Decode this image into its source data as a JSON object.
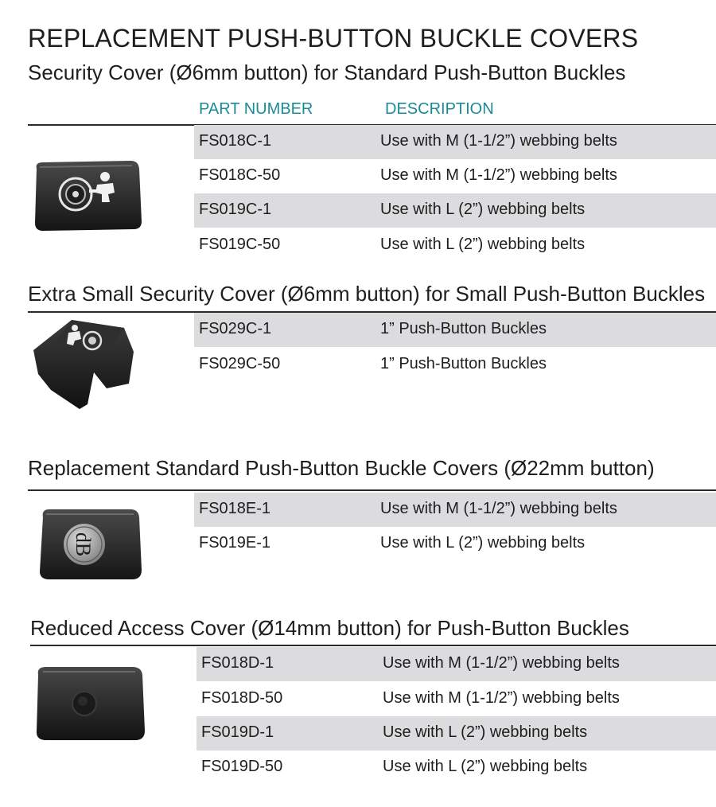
{
  "page_title": "REPLACEMENT PUSH-BUTTON BUCKLE COVERS",
  "column_headers": {
    "part_number": "PART NUMBER",
    "description": "DESCRIPTION"
  },
  "colors": {
    "header_accent": "#1a8c96",
    "row_shade": "#dcdcde",
    "rule": "#2a2a2a"
  },
  "sections": [
    {
      "title": "Security Cover (Ø6mm button) for Standard Push-Button Buckles",
      "image_icon": "security-cover-buckle",
      "rows": [
        {
          "part_number": "FS018C-1",
          "description": "Use with M (1-1/2”) webbing belts"
        },
        {
          "part_number": "FS018C-50",
          "description": "Use with M (1-1/2”) webbing belts"
        },
        {
          "part_number": "FS019C-1",
          "description": "Use with L (2”) webbing belts"
        },
        {
          "part_number": "FS019C-50",
          "description": "Use with L (2”) webbing belts"
        }
      ]
    },
    {
      "title": "Extra Small Security Cover (Ø6mm button) for Small Push-Button Buckles",
      "image_icon": "extra-small-security-cover",
      "rows": [
        {
          "part_number": "FS029C-1",
          "description": "1” Push-Button Buckles"
        },
        {
          "part_number": "FS029C-50",
          "description": "1” Push-Button Buckles"
        }
      ]
    },
    {
      "title": "Replacement Standard Push-Button Buckle Covers (Ø22mm button)",
      "image_icon": "standard-buckle-cover-db-logo",
      "rows": [
        {
          "part_number": "FS018E-1",
          "description": "Use with M (1-1/2”) webbing belts"
        },
        {
          "part_number": "FS019E-1",
          "description": "Use with L (2”) webbing belts"
        }
      ]
    },
    {
      "title": "Reduced Access Cover (Ø14mm button) for Push-Button Buckles",
      "image_icon": "reduced-access-cover",
      "rows": [
        {
          "part_number": "FS018D-1",
          "description": "Use with M (1-1/2”) webbing belts"
        },
        {
          "part_number": "FS018D-50",
          "description": "Use with M (1-1/2”) webbing belts"
        },
        {
          "part_number": "FS019D-1",
          "description": "Use with L (2”) webbing belts"
        },
        {
          "part_number": "FS019D-50",
          "description": "Use with L (2”) webbing belts"
        }
      ]
    }
  ]
}
